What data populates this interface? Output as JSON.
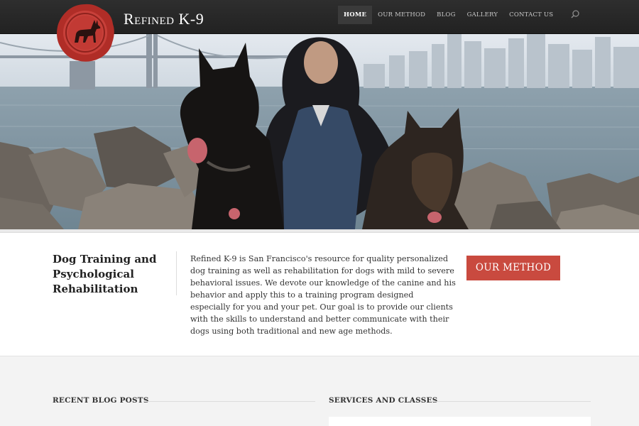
{
  "brand": {
    "name": "Refined K-9",
    "logo_icon": "dog-wax-seal-icon"
  },
  "nav": {
    "items": [
      {
        "label": "HOME",
        "active": true
      },
      {
        "label": "OUR METHOD",
        "active": false
      },
      {
        "label": "BLOG",
        "active": false
      },
      {
        "label": "GALLERY",
        "active": false
      },
      {
        "label": "CONTACT US",
        "active": false
      }
    ],
    "search_icon": "search-icon"
  },
  "hero": {
    "image": "woman-with-two-german-shepherds-at-san-francisco-bay"
  },
  "intro": {
    "title": "Dog Training and Psychological Rehabilitation",
    "body": "Refined K-9 is San Francisco's resource for quality personalized dog training as well as rehabilitation for dogs with mild to severe behavioral issues. We devote our knowledge of the canine and his behavior and apply this to a training program designed especially for you and your pet. Our goal is to provide our clients with the skills to understand and better communicate with their dogs using both traditional and new age methods.",
    "cta_label": "OUR METHOD"
  },
  "sections": {
    "blog_title": "RECENT BLOG POSTS",
    "services_title": "SERVICES AND CLASSES"
  },
  "colors": {
    "navbar": "#262626",
    "accent": "#c94a3f",
    "seal": "#b5302a",
    "background": "#f3f3f3"
  }
}
